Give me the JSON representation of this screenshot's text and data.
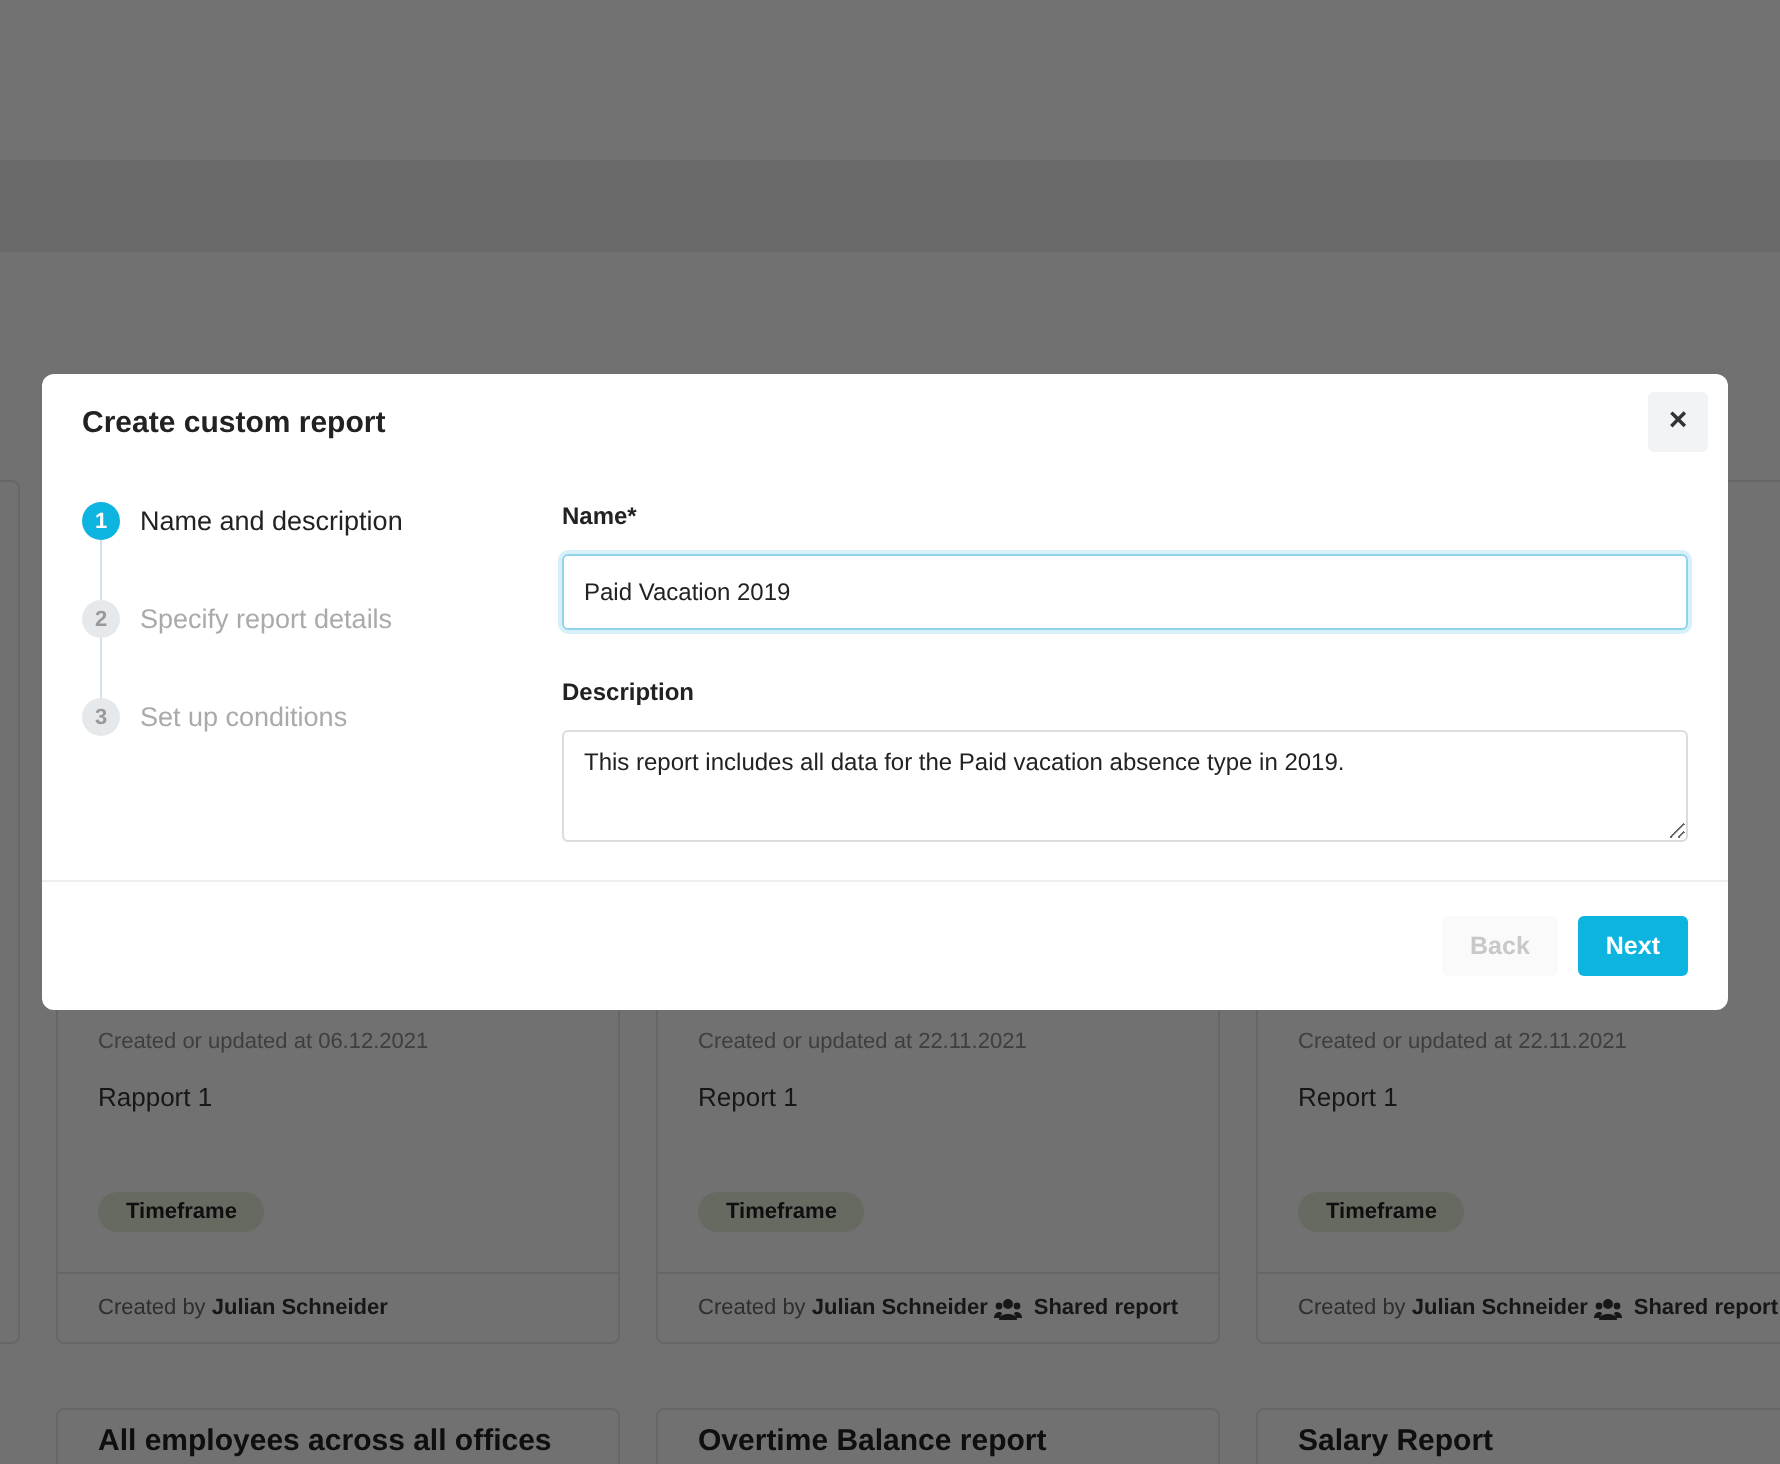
{
  "background": {
    "cards": [
      {
        "updated": "Created or updated at 06.12.2021",
        "description": "Rapport 1",
        "tag": "Timeframe",
        "created_by": "Created by **Julian Schneider**"
      },
      {
        "updated": "Created or updated at 22.11.2021",
        "description": "Report 1",
        "tag": "Timeframe",
        "created_by": "Created by **Julian Schneider**",
        "shared": "Shared report"
      },
      {
        "updated": "Created or updated at 22.11.2021",
        "description": "Report 1",
        "tag": "Timeframe",
        "created_by": "Created by **Julian Schneider**",
        "shared": "Shared report"
      }
    ],
    "next_cards": [
      {
        "title": "All employees across all offices"
      },
      {
        "title": "Overtime Balance report"
      },
      {
        "title": "Salary Report"
      }
    ]
  },
  "modal": {
    "title": "Create custom report",
    "close": "×",
    "steps": [
      {
        "number": "1",
        "label": "Name and description",
        "selected": true
      },
      {
        "number": "2",
        "label": "Specify report details",
        "selected": false
      },
      {
        "number": "3",
        "label": "Set up conditions",
        "selected": false
      }
    ],
    "name_field": {
      "label": "Name*",
      "value": "Paid Vacation 2019",
      "focused": true
    },
    "description_field": {
      "label": "Description",
      "value": "This report includes all data for the Paid vacation absence type in 2019."
    },
    "buttons": {
      "back": {
        "label": "Back",
        "disabled": true
      },
      "next": {
        "label": "Next",
        "disabled": false
      }
    }
  }
}
